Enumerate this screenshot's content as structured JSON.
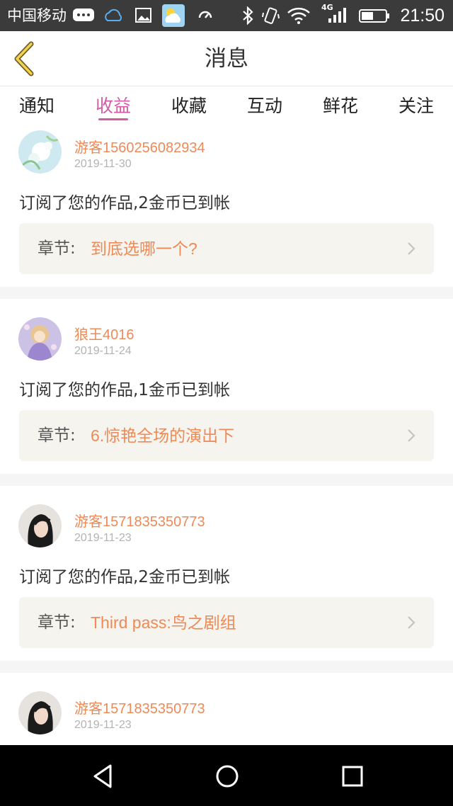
{
  "status_bar": {
    "carrier": "中国移动",
    "network": "4G",
    "time": "21:50",
    "icons": [
      "chat-icon",
      "weather-icon",
      "gallery-icon",
      "app-icon",
      "sync-icon",
      "bluetooth-icon",
      "vibrate-icon",
      "wifi-icon",
      "signal-icon",
      "battery-icon"
    ]
  },
  "nav": {
    "title": "消息",
    "back_icon": "back-chevron-icon"
  },
  "tabs": [
    {
      "label": "通知",
      "active": false
    },
    {
      "label": "收益",
      "active": true
    },
    {
      "label": "收藏",
      "active": false
    },
    {
      "label": "互动",
      "active": false
    },
    {
      "label": "鲜花",
      "active": false
    },
    {
      "label": "关注",
      "active": false
    }
  ],
  "messages": [
    {
      "user": "游客1560256082934",
      "date": "2019-11-30",
      "text": "订阅了您的作品,2金币已到帐",
      "chapter_label": "章节:",
      "chapter_title": "到底选哪一个?"
    },
    {
      "user": "狼王4016",
      "date": "2019-11-24",
      "text": "订阅了您的作品,1金币已到帐",
      "chapter_label": "章节:",
      "chapter_title": "6.惊艳全场的演出下"
    },
    {
      "user": "游客1571835350773",
      "date": "2019-11-23",
      "text": "订阅了您的作品,2金币已到帐",
      "chapter_label": "章节:",
      "chapter_title": "Third pass:鸟之剧组"
    },
    {
      "user": "游客1571835350773",
      "date": "2019-11-23"
    }
  ],
  "colors": {
    "accent": "#d45aa6",
    "highlight": "#ee8a57",
    "status_bar": "#3b3b3b",
    "chapter_bg": "#f5f4ee"
  }
}
